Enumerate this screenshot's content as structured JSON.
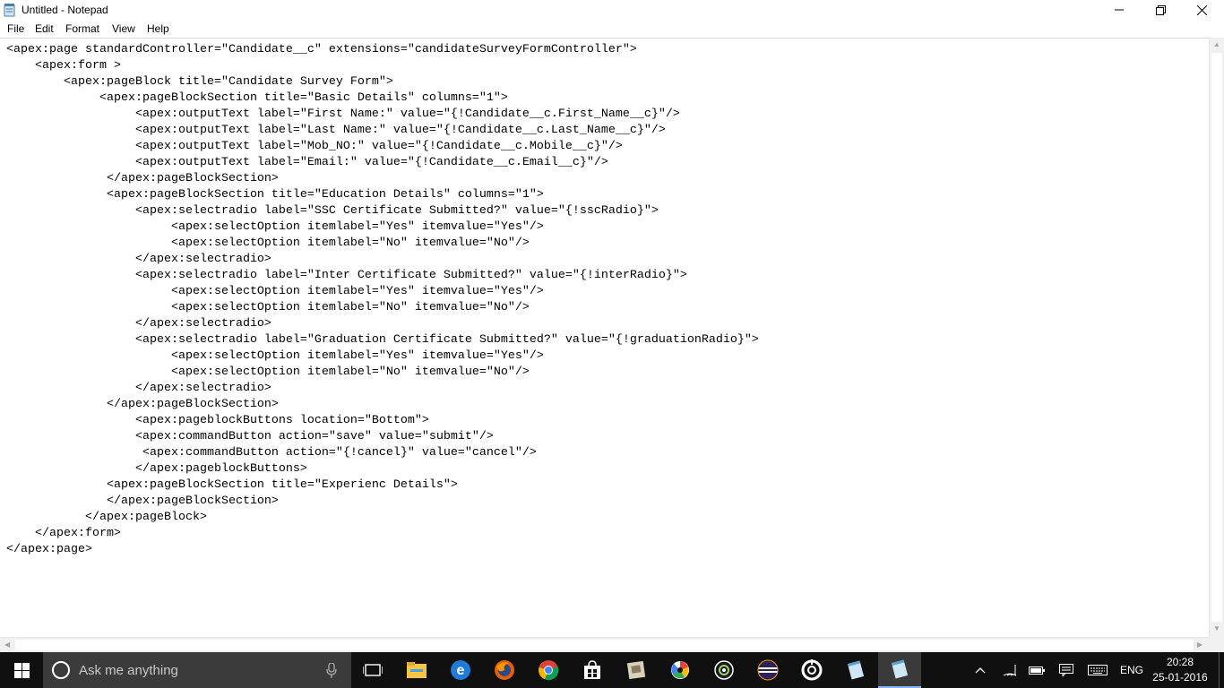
{
  "window": {
    "title": "Untitled - Notepad",
    "controls": {
      "minimize": "—",
      "maximize": "❐",
      "close": "✕"
    }
  },
  "menu": {
    "items": [
      "File",
      "Edit",
      "Format",
      "View",
      "Help"
    ]
  },
  "editor": {
    "content": "<apex:page standardController=\"Candidate__c\" extensions=\"candidateSurveyFormController\">\n    <apex:form >\n        <apex:pageBlock title=\"Candidate Survey Form\">\n             <apex:pageBlockSection title=\"Basic Details\" columns=\"1\">\n                  <apex:outputText label=\"First Name:\" value=\"{!Candidate__c.First_Name__c}\"/>\n                  <apex:outputText label=\"Last Name:\" value=\"{!Candidate__c.Last_Name__c}\"/>\n                  <apex:outputText label=\"Mob_NO:\" value=\"{!Candidate__c.Mobile__c}\"/>\n                  <apex:outputText label=\"Email:\" value=\"{!Candidate__c.Email__c}\"/>\n              </apex:pageBlockSection>\n              <apex:pageBlockSection title=\"Education Details\" columns=\"1\">\n                  <apex:selectradio label=\"SSC Certificate Submitted?\" value=\"{!sscRadio}\">\n                       <apex:selectOption itemlabel=\"Yes\" itemvalue=\"Yes\"/>\n                       <apex:selectOption itemlabel=\"No\" itemvalue=\"No\"/>\n                  </apex:selectradio>\n                  <apex:selectradio label=\"Inter Certificate Submitted?\" value=\"{!interRadio}\">\n                       <apex:selectOption itemlabel=\"Yes\" itemvalue=\"Yes\"/>\n                       <apex:selectOption itemlabel=\"No\" itemvalue=\"No\"/>\n                  </apex:selectradio>\n                  <apex:selectradio label=\"Graduation Certificate Submitted?\" value=\"{!graduationRadio}\">\n                       <apex:selectOption itemlabel=\"Yes\" itemvalue=\"Yes\"/>\n                       <apex:selectOption itemlabel=\"No\" itemvalue=\"No\"/>\n                  </apex:selectradio>\n              </apex:pageBlockSection>\n                  <apex:pageblockButtons location=\"Bottom\">\n                  <apex:commandButton action=\"save\" value=\"submit\"/>\n                   <apex:commandButton action=\"{!cancel}\" value=\"cancel\"/>\n                  </apex:pageblockButtons>\n              <apex:pageBlockSection title=\"Experienc Details\">\n              </apex:pageBlockSection>\n           </apex:pageBlock>\n    </apex:form>\n</apex:page>"
  },
  "taskbar": {
    "search_placeholder": "Ask me anything",
    "apps": [
      "task-view",
      "file-explorer",
      "edge",
      "firefox",
      "chrome",
      "store",
      "app-generic",
      "picasa",
      "camera",
      "eclipse",
      "app-circle",
      "notepad-pinned",
      "notepad-active"
    ],
    "language": "ENG",
    "time": "20:28",
    "date": "25-01-2016"
  },
  "colors": {
    "taskbar": "#101010",
    "search_bg": "#3b3b3b",
    "edge_blue": "#1e7bd8",
    "active_underline": "#8ab4f8"
  }
}
